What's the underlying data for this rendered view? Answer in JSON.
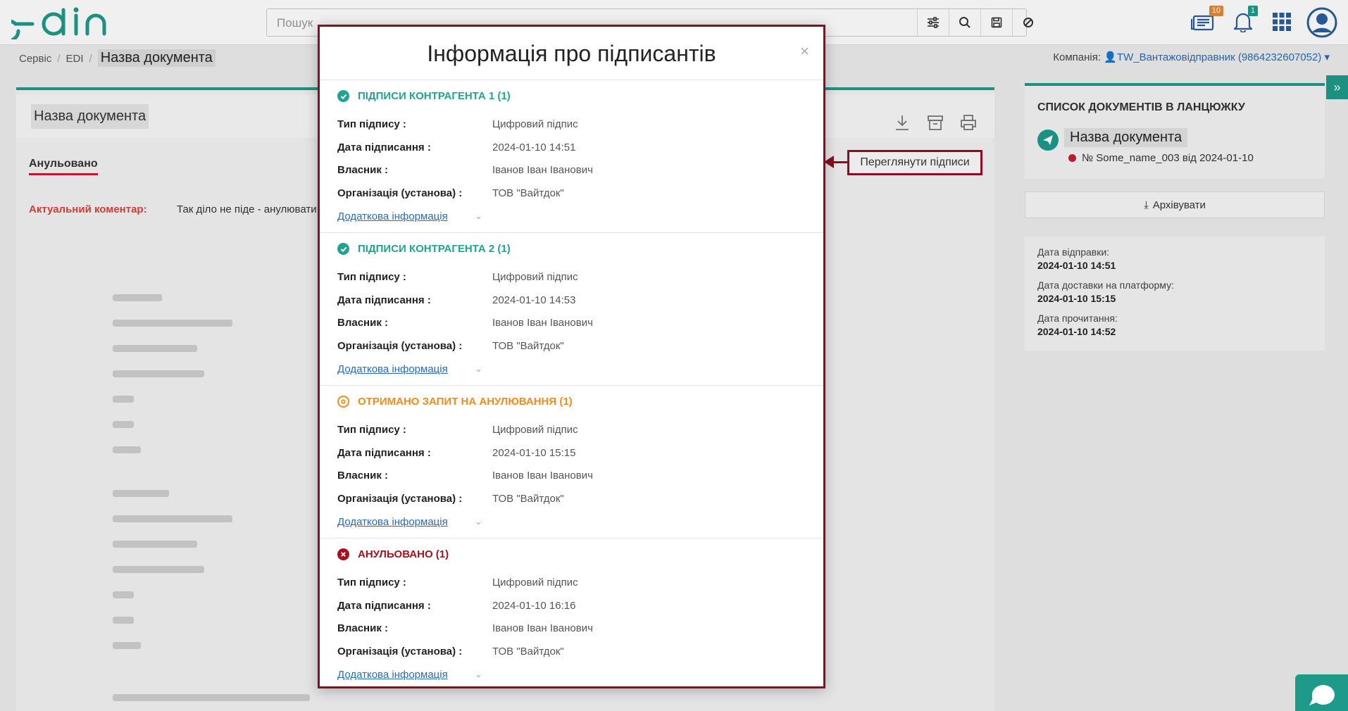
{
  "header": {
    "search_placeholder": "Пошук",
    "messages_count": "10",
    "notifications_count": "1"
  },
  "breadcrumb": {
    "items": [
      "Сервіс",
      "EDI"
    ],
    "current": "Назва документа"
  },
  "company": {
    "label": "Компанія:",
    "name": "TW_Вантажовідправник (9864232607052)"
  },
  "document": {
    "title": "Назва документа",
    "status_tab": "Анульовано",
    "comment_label": "Актуальний коментар:",
    "comment_text": "Так діло не піде - анулювати"
  },
  "callout": {
    "label": "Переглянути підписи"
  },
  "chain": {
    "title": "СПИСОК ДОКУМЕНТІВ В ЛАНЦЮЖКУ",
    "doc_name": "Назва документа",
    "doc_sub": "№ Some_name_003 від 2024-01-10"
  },
  "archive_label": "Архівувати",
  "dates": [
    {
      "label": "Дата відправки:",
      "value": "2024-01-10 14:51"
    },
    {
      "label": "Дата доставки на платформу:",
      "value": "2024-01-10 15:15"
    },
    {
      "label": "Дата прочитання:",
      "value": "2024-01-10 14:52"
    }
  ],
  "modal": {
    "title": "Інформація про підписантів",
    "close": "×",
    "field_labels": {
      "type": "Тип підпису :",
      "date": "Дата підписання :",
      "owner": "Власник :",
      "org": "Організація (установа) :"
    },
    "more_label": "Додаткова інформація",
    "sections": [
      {
        "heading": "ПІДПИСИ КОНТРАГЕНТА 1 (1)",
        "color": "#21a48f",
        "icon": "check-circle-icon",
        "type": "Цифровий підпис",
        "date": "2024-01-10 14:51",
        "owner": "Іванов Іван Іванович",
        "org": "ТОВ \"Вайтдок\""
      },
      {
        "heading": "ПІДПИСИ КОНТРАГЕНТА 2 (1)",
        "color": "#21a48f",
        "icon": "check-circle-icon",
        "type": "Цифровий підпис",
        "date": "2024-01-10 14:53",
        "owner": "Іванов Іван Іванович",
        "org": "ТОВ \"Вайтдок\""
      },
      {
        "heading": "ОТРИМАНО ЗАПИТ НА АНУЛЮВАННЯ (1)",
        "color": "#f08c1a",
        "icon": "cancel-request-icon",
        "type": "Цифровий підпис",
        "date": "2024-01-10 15:15",
        "owner": "Іванов Іван Іванович",
        "org": "ТОВ \"Вайтдок\""
      },
      {
        "heading": "АНУЛЬОВАНО (1)",
        "color": "#a3121d",
        "icon": "cross-circle-icon",
        "type": "Цифровий підпис",
        "date": "2024-01-10 16:16",
        "owner": "Іванов Іван Іванович",
        "org": "ТОВ \"Вайтдок\""
      }
    ]
  },
  "colors": {
    "accent": "#1e9a8a",
    "callout": "#8b0d1f",
    "link": "#2a6bb1"
  }
}
